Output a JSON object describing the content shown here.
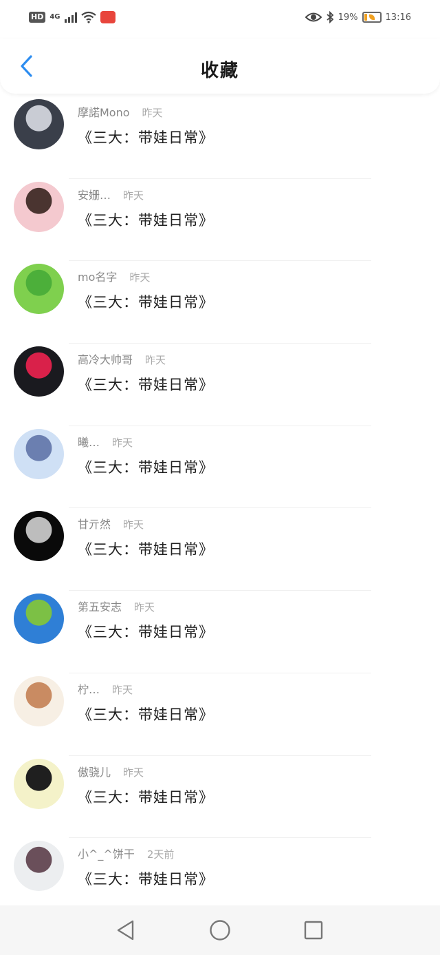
{
  "status_bar": {
    "hd": "HD",
    "network": "4G",
    "battery_text": "19%",
    "time": "13:16"
  },
  "header": {
    "title": "收藏"
  },
  "items": [
    {
      "name": "摩諾Mono",
      "time": "昨天",
      "message": "《三大：带娃日常》",
      "avatar_colors": [
        "#3a3f4a",
        "#c9ccd4"
      ]
    },
    {
      "name": "安姗…",
      "time": "昨天",
      "message": "《三大：带娃日常》",
      "avatar_colors": [
        "#f4c9cf",
        "#4a3430"
      ]
    },
    {
      "name": "mo名字",
      "time": "昨天",
      "message": "《三大：带娃日常》",
      "avatar_colors": [
        "#7fd04e",
        "#4caf3a"
      ]
    },
    {
      "name": "高冷大帅哥",
      "time": "昨天",
      "message": "《三大：带娃日常》",
      "avatar_colors": [
        "#1a1a1f",
        "#d9214a"
      ]
    },
    {
      "name": "曦…",
      "time": "昨天",
      "message": "《三大：带娃日常》",
      "avatar_colors": [
        "#cfe0f5",
        "#6b7fb0"
      ]
    },
    {
      "name": "甘亓然",
      "time": "昨天",
      "message": "《三大：带娃日常》",
      "avatar_colors": [
        "#0a0a0a",
        "#bdbdbd"
      ]
    },
    {
      "name": "第五安志",
      "time": "昨天",
      "message": "《三大：带娃日常》",
      "avatar_colors": [
        "#2f7fd6",
        "#7cc045"
      ]
    },
    {
      "name": "柠…",
      "time": "昨天",
      "message": "《三大：带娃日常》",
      "avatar_colors": [
        "#f7efe4",
        "#c98b62"
      ]
    },
    {
      "name": "傲骁儿",
      "time": "昨天",
      "message": "《三大：带娃日常》",
      "avatar_colors": [
        "#f4f2c9",
        "#1f1f1f"
      ]
    },
    {
      "name": "小^_^饼干",
      "time": "2天前",
      "message": "《三大：带娃日常》",
      "avatar_colors": [
        "#eceef0",
        "#6a4f5a"
      ]
    }
  ],
  "nav_icons": [
    "back-triangle",
    "home-circle",
    "recents-square"
  ]
}
